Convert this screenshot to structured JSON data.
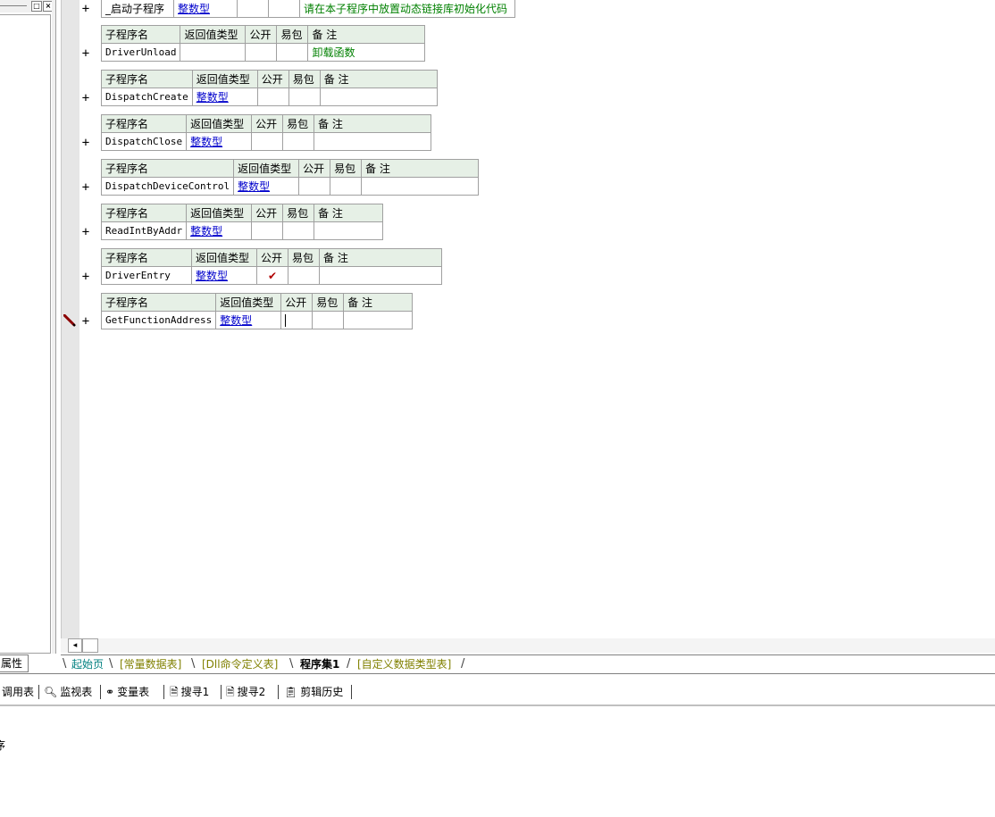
{
  "table_headers": {
    "name": "子程序名",
    "return_type": "返回值类型",
    "public": "公开",
    "easy_pack": "易包",
    "remark": "备 注"
  },
  "subroutines": [
    {
      "name": "_启动子程序",
      "return_type": "整数型",
      "public_mark": "",
      "remark": "请在本子程序中放置动态链接库初始化代码"
    },
    {
      "name": "DriverUnload",
      "return_type": "",
      "public_mark": "",
      "remark": "卸载函数"
    },
    {
      "name": "DispatchCreate",
      "return_type": "整数型",
      "public_mark": "",
      "remark": ""
    },
    {
      "name": "DispatchClose",
      "return_type": "整数型",
      "public_mark": "",
      "remark": ""
    },
    {
      "name": "DispatchDeviceControl",
      "return_type": "整数型",
      "public_mark": "",
      "remark": ""
    },
    {
      "name": "ReadIntByAddr",
      "return_type": "整数型",
      "public_mark": "",
      "remark": ""
    },
    {
      "name": "DriverEntry",
      "return_type": "整数型",
      "public_mark": "✔",
      "remark": ""
    },
    {
      "name": "GetFunctionAddress",
      "return_type": "整数型",
      "public_mark": "",
      "remark": ""
    }
  ],
  "expand_symbol": "+",
  "left_panel": {
    "properties_tab": "属性",
    "pin_symbol": "□",
    "close_symbol": "×"
  },
  "file_tabs": [
    {
      "label": "起始页"
    },
    {
      "label": "[常量数据表]"
    },
    {
      "label": "[Dll命令定义表]"
    },
    {
      "label": "程序集1"
    },
    {
      "label": "[自定义数据类型表]"
    }
  ],
  "tool_tabs": [
    {
      "label": "调用表",
      "icon": "call-table-icon"
    },
    {
      "label": "监视表",
      "icon": "magnifier-icon"
    },
    {
      "label": "变量表",
      "icon": "variables-icon"
    },
    {
      "label": "搜寻1",
      "icon": "search-doc-icon"
    },
    {
      "label": "搜寻2",
      "icon": "search-doc-icon"
    },
    {
      "label": "剪辑历史",
      "icon": "clipboard-icon"
    }
  ],
  "output_text": "序",
  "colors": {
    "header_bg": "#e6f0e6",
    "type_link": "#0000cc",
    "remark_green": "#008000",
    "check_red": "#b00000"
  }
}
